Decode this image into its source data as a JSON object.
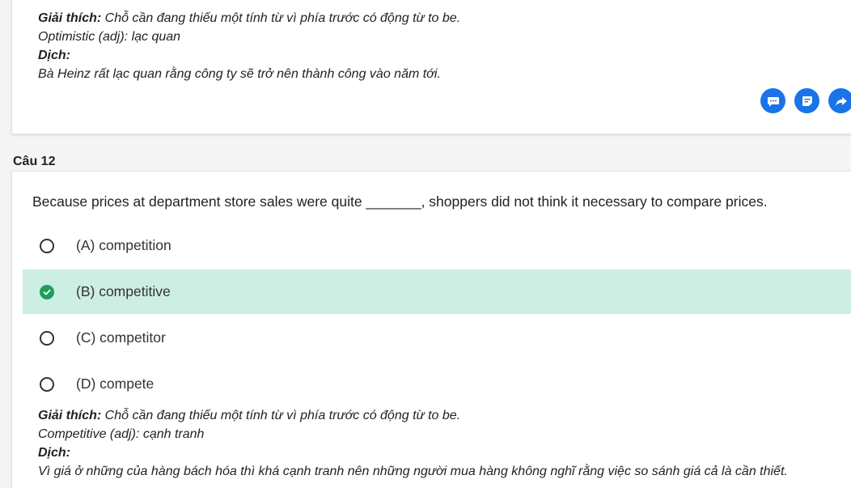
{
  "previous": {
    "explanation": {
      "label": "Giải thích:",
      "text": " Chỗ cần đang thiếu một tính từ vì phía trước có động từ to be.",
      "vocab": "Optimistic (adj): lạc quan",
      "translation_label": "Dịch:",
      "translation": "Bà Heinz rất lạc quan rằng công ty sẽ trở nên thành công vào năm tới."
    },
    "actions": [
      {
        "icon": "comment-icon"
      },
      {
        "icon": "note-icon"
      },
      {
        "icon": "share-icon"
      }
    ]
  },
  "question": {
    "label": "Câu 12",
    "text": "Because prices at department store sales were quite _______, shoppers did not think it necessary to compare prices.",
    "options": [
      {
        "label": "(A) competition",
        "correct": false
      },
      {
        "label": "(B) competitive",
        "correct": true
      },
      {
        "label": "(C) competitor",
        "correct": false
      },
      {
        "label": "(D) compete",
        "correct": false
      }
    ],
    "explanation": {
      "label": "Giải thích:",
      "text": " Chỗ cần đang thiếu một tính từ vì phía trước có động từ to be.",
      "vocab": "Competitive (adj): cạnh tranh",
      "translation_label": "Dịch:",
      "translation": "Vì giá ở những của hàng bách hóa thì khá cạnh tranh nên những người mua hàng không nghĩ rằng việc so sánh giá cả là cần thiết."
    }
  },
  "colors": {
    "accent": "#1a73e8",
    "correct_bg": "#cdeee3",
    "correct_check": "#1e9e5a"
  }
}
